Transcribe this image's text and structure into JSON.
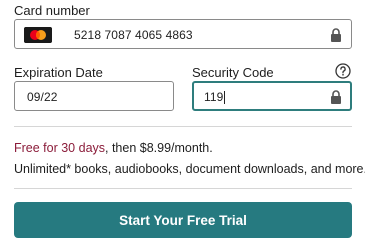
{
  "card": {
    "label": "Card number",
    "value": "5218 7087 4065 4863",
    "brand_icon": "mastercard-icon"
  },
  "expiration": {
    "label": "Expiration Date",
    "value": "09/22"
  },
  "security_code": {
    "label": "Security Code",
    "value": "119",
    "help_icon": "question-circle-icon"
  },
  "promo": {
    "accent_text": "Free for 30 days",
    "rest_text": ", then $8.99/month."
  },
  "description": "Unlimited* books, audiobooks, document downloads, and more.",
  "cta": {
    "label": "Start Your Free Trial"
  },
  "colors": {
    "accent": "#267a80",
    "promo": "#8b1c3a",
    "focus_border": "#2e7d7d"
  }
}
